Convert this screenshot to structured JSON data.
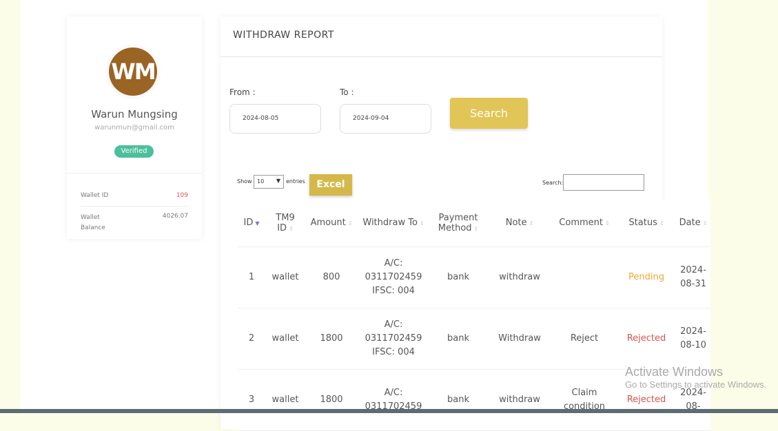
{
  "profile": {
    "initials": "WM",
    "name": "Warun Mungsing",
    "email": "warunmun@gmail.com",
    "badge": "Verified",
    "wallet_id_label": "Wallet ID",
    "wallet_id": "109",
    "wallet_balance_label": "Wallet Balance",
    "wallet_balance": "4026.07"
  },
  "report": {
    "title": "WITHDRAW REPORT",
    "from_label": "From :",
    "to_label": "To :",
    "from_value": "2024-08-05",
    "to_value": "2024-09-04",
    "search_button": "Search",
    "show_label": "Show",
    "entries_value": "10",
    "entries_label": "entries",
    "excel_button": "Excel",
    "search_label": "Search:"
  },
  "table": {
    "headers": [
      "ID",
      "TM9 ID",
      "Amount",
      "Withdraw To",
      "Payment Method",
      "Note",
      "Comment",
      "Status",
      "Date"
    ],
    "rows": [
      {
        "id": "1",
        "tm9": "wallet",
        "amount": "800",
        "to": "A/C: 0311702459 IFSC: 004",
        "method": "bank",
        "note": "withdraw",
        "comment": "",
        "status": "Pending",
        "date": "2024-08-31"
      },
      {
        "id": "2",
        "tm9": "wallet",
        "amount": "1800",
        "to": "A/C: 0311702459 IFSC: 004",
        "method": "bank",
        "note": "Withdraw",
        "comment": "Reject",
        "status": "Rejected",
        "date": "2024-08-10"
      },
      {
        "id": "3",
        "tm9": "wallet",
        "amount": "1800",
        "to": "A/C: 0311702459",
        "method": "bank",
        "note": "withdraw",
        "comment": "Claim condition",
        "status": "Rejected",
        "date": "2024-08-"
      }
    ]
  },
  "colors": {
    "pending": "#f0a830",
    "rejected": "#d9534f",
    "accent": "#e2c557"
  },
  "watermark": {
    "title": "Activate Windows",
    "sub": "Go to Settings to activate Windows."
  }
}
